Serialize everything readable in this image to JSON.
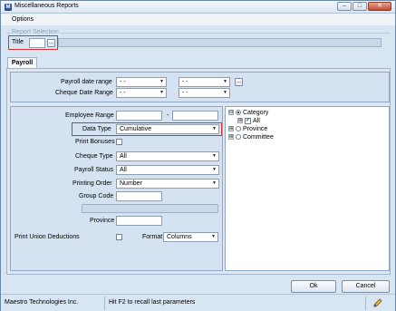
{
  "window": {
    "title": "Miscellaneous Reports",
    "app_icon": "M",
    "buttons": {
      "minimize": "–",
      "maximize": "□",
      "close": "✕"
    }
  },
  "menu": {
    "options": "Options"
  },
  "report_selection": {
    "group_title": "Report Selection",
    "title_label": "Title",
    "title_value": "",
    "browse_label": "..."
  },
  "tabs": [
    {
      "label": "Payroll"
    }
  ],
  "dates": {
    "payroll_date_range_label": "Payroll date range",
    "cheque_date_range_label": "Cheque Date Range",
    "placeholder": "-   -",
    "browse_label": "..."
  },
  "form": {
    "employee_range_label": "Employee Range",
    "employee_range_from": "",
    "employee_range_to": "",
    "range_separator": "-",
    "data_type_label": "Data Type",
    "data_type_value": "Cumulative",
    "print_bonuses_label": "Print Bonuses",
    "cheque_type_label": "Cheque Type",
    "cheque_type_value": "All",
    "payroll_status_label": "Payroll Status",
    "payroll_status_value": "All",
    "printing_order_label": "Printing Order",
    "printing_order_value": "Number",
    "group_code_label": "Group Code",
    "group_code_value": "",
    "group_desc_value": "",
    "province_label": "Province",
    "province_value": "",
    "print_union_label": "Print Union Deductions",
    "format_label": "Format",
    "format_value": "Columns"
  },
  "tree": {
    "items": [
      {
        "label": "Category",
        "expand": "⊟",
        "selected": true
      },
      {
        "label": "All",
        "expand": "⊞",
        "checked": true
      },
      {
        "label": "Province",
        "expand": "⊞",
        "selected": false
      },
      {
        "label": "Committee",
        "expand": "⊞",
        "selected": false
      }
    ]
  },
  "buttons": {
    "ok": "Ok",
    "cancel": "Cancel"
  },
  "status": {
    "company": "Maestro Technologies Inc.",
    "hint": "Hit F2 to recall last parameters"
  },
  "colors": {
    "highlight": "#d9333a",
    "accent": "#2d4f9e"
  }
}
